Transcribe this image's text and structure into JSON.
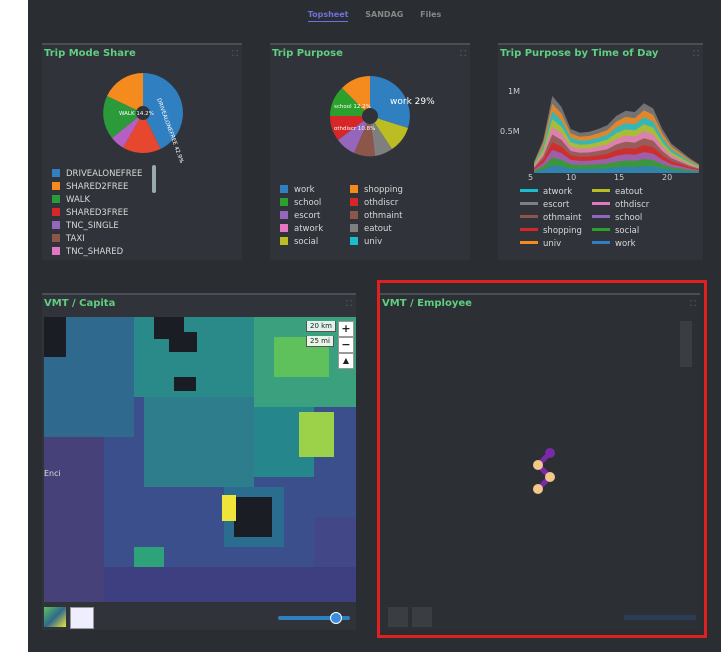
{
  "tabs": [
    "Topsheet",
    "SANDAG",
    "Files"
  ],
  "panels": {
    "mode_share": {
      "title": "Trip Mode Share",
      "legend": [
        "DRIVEALONEFREE",
        "SHARED2FREE",
        "WALK",
        "SHARED3FREE",
        "TNC_SINGLE",
        "TAXI",
        "TNC_SHARED"
      ],
      "slice_labels": [
        "DRIVEALONEFREE 42.9%",
        "WALK 14.2%"
      ]
    },
    "purpose": {
      "title": "Trip Purpose",
      "legend_left": [
        "work",
        "school",
        "escort",
        "atwork",
        "social"
      ],
      "legend_right": [
        "shopping",
        "othdiscr",
        "othmaint",
        "eatout",
        "univ"
      ],
      "slice_labels": [
        "work 29%",
        "school 12.2%",
        "othdiscr 10.8%"
      ]
    },
    "time_of_day": {
      "title": "Trip Purpose by Time of Day",
      "y_ticks": [
        "1M",
        "0.5M"
      ],
      "x_ticks": [
        "5",
        "10",
        "15",
        "20"
      ],
      "legend_left": [
        "atwork",
        "escort",
        "othmaint",
        "shopping",
        "univ"
      ],
      "legend_right": [
        "eatout",
        "othdiscr",
        "school",
        "social",
        "work"
      ]
    },
    "vmt_capita": {
      "title": "VMT / Capita",
      "scale_km": "20 km",
      "scale_mi": "25 mi",
      "place_label": "Enci"
    },
    "vmt_employee": {
      "title": "VMT / Employee"
    }
  },
  "colors": {
    "accent": "#5fcf80",
    "active_tab": "#6e72d8",
    "highlight": "#e02020"
  },
  "chart_data": [
    {
      "type": "pie",
      "title": "Trip Mode Share",
      "categories": [
        "DRIVEALONEFREE",
        "SHARED2FREE",
        "WALK",
        "SHARED3FREE",
        "TNC_SINGLE",
        "TAXI",
        "TNC_SHARED"
      ],
      "values": [
        42.9,
        20.5,
        14.2,
        12.0,
        4.5,
        3.0,
        2.9
      ]
    },
    {
      "type": "pie",
      "title": "Trip Purpose",
      "categories": [
        "work",
        "shopping",
        "school",
        "othdiscr",
        "escort",
        "othmaint",
        "atwork",
        "eatout",
        "social",
        "univ"
      ],
      "values": [
        29,
        13,
        12.2,
        10.8,
        9,
        8,
        6,
        5,
        4,
        3
      ]
    },
    {
      "type": "area",
      "title": "Trip Purpose by Time of Day",
      "x": [
        5,
        6,
        7,
        8,
        9,
        10,
        11,
        12,
        13,
        14,
        15,
        16,
        17,
        18,
        19,
        20,
        21,
        22,
        23
      ],
      "ylim": [
        0,
        1200000
      ],
      "series_total": [
        150000,
        450000,
        1050000,
        900000,
        600000,
        550000,
        560000,
        600000,
        650000,
        780000,
        850000,
        830000,
        950000,
        880000,
        600000,
        400000,
        300000,
        200000,
        120000
      ]
    }
  ]
}
